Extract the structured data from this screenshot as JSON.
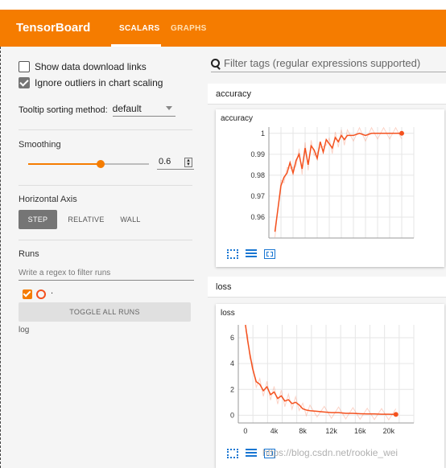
{
  "app": {
    "brand": "TensorBoard"
  },
  "tabs": [
    {
      "label": "SCALARS",
      "active": true
    },
    {
      "label": "GRAPHS",
      "active": false
    }
  ],
  "colors": {
    "accent": "#f57c00",
    "series": "#f4511e",
    "link": "#1976d2"
  },
  "sidebar": {
    "show_download": {
      "label": "Show data download links",
      "checked": false
    },
    "ignore_outliers": {
      "label": "Ignore outliers in chart scaling",
      "checked": true
    },
    "tooltip": {
      "label": "Tooltip sorting method:",
      "value": "default"
    },
    "smoothing": {
      "title": "Smoothing",
      "value": "0.6",
      "level": 0.6
    },
    "horizontal_axis": {
      "title": "Horizontal Axis",
      "options": [
        "STEP",
        "RELATIVE",
        "WALL"
      ],
      "selected": "STEP"
    },
    "runs": {
      "title": "Runs",
      "filter_placeholder": "Write a regex to filter runs",
      "run_dot": ".",
      "toggle_label": "TOGGLE ALL RUNS",
      "run_name": "log"
    }
  },
  "main": {
    "search_placeholder": "Filter tags (regular expressions supported)",
    "groups": [
      {
        "name": "accuracy"
      },
      {
        "name": "loss"
      }
    ]
  },
  "chart_data": [
    {
      "type": "line",
      "title": "accuracy",
      "ylim": [
        0.95,
        1.003
      ],
      "yticks": [
        "1",
        "0.99",
        "0.98",
        "0.97",
        "0.96"
      ],
      "yticks_values": [
        1,
        0.99,
        0.98,
        0.97,
        0.96
      ],
      "grid": true,
      "x": [
        0,
        1000,
        1500,
        2000,
        2500,
        3000,
        3500,
        4000,
        4500,
        5000,
        5500,
        6000,
        6500,
        7000,
        7500,
        8000,
        8500,
        9000,
        9500,
        10000,
        10500,
        11000,
        11500,
        12000,
        13000,
        14000,
        15000,
        16000,
        17000,
        18000,
        19000,
        20000,
        21000
      ],
      "series": [
        {
          "values": [
            0.953,
            0.975,
            0.979,
            0.981,
            0.986,
            0.981,
            0.987,
            0.99,
            0.983,
            0.993,
            0.985,
            0.994,
            0.992,
            0.988,
            0.996,
            0.991,
            0.997,
            0.995,
            0.993,
            0.998,
            0.996,
            0.999,
            0.997,
            0.999,
            0.999,
            1.0,
            0.999,
            1.0,
            1.0,
            1.0,
            1.0,
            1.0,
            1.0
          ]
        }
      ]
    },
    {
      "type": "line",
      "title": "loss",
      "xlim": [
        -1000,
        23500
      ],
      "ylim": [
        -0.6,
        7.0
      ],
      "xticks": [
        "0",
        "4k",
        "8k",
        "12k",
        "16k",
        "20k"
      ],
      "xticks_values": [
        0,
        4000,
        8000,
        12000,
        16000,
        20000
      ],
      "yticks": [
        "6",
        "4",
        "2",
        "0"
      ],
      "yticks_values": [
        6,
        4,
        2,
        0
      ],
      "grid": true,
      "x": [
        0,
        300,
        600,
        1000,
        1500,
        2000,
        2500,
        3000,
        3500,
        4000,
        4500,
        5000,
        5500,
        6000,
        6500,
        7000,
        7500,
        8000,
        8500,
        9000,
        10000,
        11000,
        12000,
        13000,
        14000,
        15000,
        16000,
        17000,
        18000,
        19000,
        20000,
        21000
      ],
      "series": [
        {
          "values": [
            7.0,
            5.8,
            4.8,
            3.6,
            2.6,
            2.4,
            1.9,
            2.2,
            1.6,
            1.8,
            1.3,
            1.5,
            1.1,
            1.2,
            0.9,
            1.0,
            0.8,
            0.5,
            0.4,
            0.35,
            0.3,
            0.25,
            0.2,
            0.2,
            0.15,
            0.15,
            0.12,
            0.1,
            0.1,
            0.08,
            0.08,
            0.06
          ]
        }
      ]
    }
  ],
  "watermark": "https://blog.csdn.net/rookie_wei"
}
